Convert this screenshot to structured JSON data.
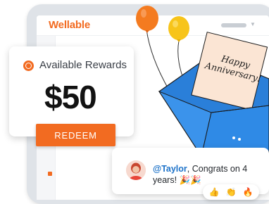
{
  "app": {
    "brand": "Wellable"
  },
  "rewards": {
    "title": "Available Rewards",
    "amount": "$50",
    "redeem_label": "REDEEM"
  },
  "envelope": {
    "line1": "Happy",
    "line2": "Anniversary!"
  },
  "chat": {
    "mention": "@Taylor",
    "message": ", Congrats on 4 years! 🎉🎉"
  },
  "reactions": [
    {
      "icon": "thumbs-up-icon",
      "glyph": "👍"
    },
    {
      "icon": "clapping-hands-icon",
      "glyph": "👏"
    },
    {
      "icon": "fire-icon",
      "glyph": "🔥"
    }
  ],
  "colors": {
    "accent": "#f26b21",
    "envelope": "#2f8ae6",
    "balloon_orange": "#f47b20",
    "balloon_yellow": "#f7c41a",
    "mention": "#1e73c9"
  }
}
